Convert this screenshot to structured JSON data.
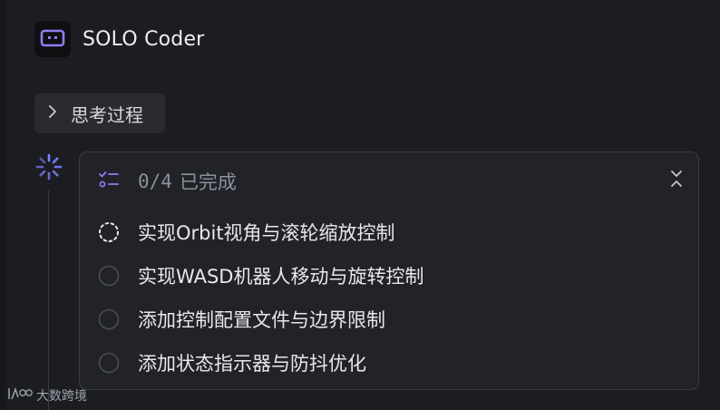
{
  "agent": {
    "name": "SOLO Coder",
    "icon": "robot-icon",
    "accent": "#8d7ff0"
  },
  "thinking": {
    "label": "思考过程",
    "icon": "chevron-right-icon"
  },
  "todo": {
    "progress": "0/4",
    "status": "已完成",
    "icon": "checklist-icon",
    "collapse_icon": "collapse-icon",
    "items": [
      {
        "text": "实现Orbit视角与滚轮缩放控制",
        "state": "in-progress"
      },
      {
        "text": "实现WASD机器人移动与旋转控制",
        "state": "pending"
      },
      {
        "text": "添加控制配置文件与边界限制",
        "state": "pending"
      },
      {
        "text": "添加状态指示器与防抖优化",
        "state": "pending"
      }
    ]
  },
  "watermark": {
    "text": "大数跨境",
    "logo": "watermark-logo"
  }
}
